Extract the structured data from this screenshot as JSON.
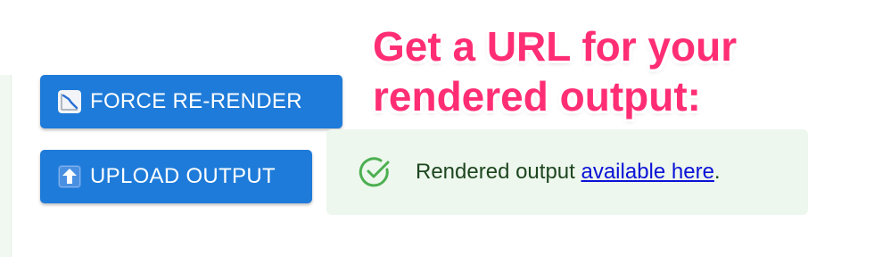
{
  "annotation": {
    "line1": "Get a URL for your",
    "line2": "rendered output:",
    "color": "#ff2e74"
  },
  "buttons": {
    "force_rerender": {
      "label": "FORCE RE-RENDER",
      "icon": "chart-decreasing-icon"
    },
    "upload_output": {
      "label": "UPLOAD OUTPUT",
      "icon": "up-arrow-icon"
    },
    "color": "#1e7bd9"
  },
  "alert": {
    "status": "success",
    "icon": "check-circle-icon",
    "text_before": "Rendered output ",
    "link_text": "available here",
    "text_after": ".",
    "background": "#edf7ed",
    "icon_color": "#4caf50"
  }
}
